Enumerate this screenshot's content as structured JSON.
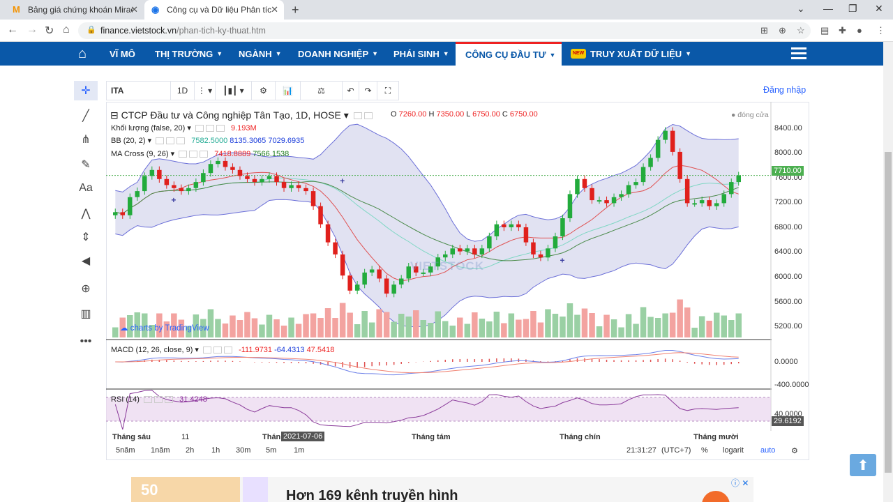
{
  "browser": {
    "tabs": [
      {
        "title": "Bảng giá chứng khoán Mirae Asset",
        "icon": "mirae-favicon",
        "active": false
      },
      {
        "title": "Công cụ và Dữ liệu Phân tích kỹ thuật",
        "icon": "vietstock-favicon",
        "active": true
      }
    ],
    "new_tab": "+",
    "url_host": "finance.vietstock.vn",
    "url_path": "/phan-tich-ky-thuat.htm"
  },
  "nav": {
    "items": [
      "VĨ MÔ",
      "THỊ TRƯỜNG",
      "NGÀNH",
      "DOANH NGHIỆP",
      "PHÁI SINH",
      "CÔNG CỤ ĐẦU TƯ",
      "TRUY XUẤT DỮ LIỆU"
    ],
    "active": "CÔNG CỤ ĐẦU TƯ",
    "new_badge": "NEW"
  },
  "toolbar": {
    "symbol": "ITA",
    "interval": "1D",
    "login": "Đăng nhập"
  },
  "legend": {
    "title": "CTCP Đầu tư và Công nghiệp Tân Tạo, 1D, HOSE",
    "o_label": "O",
    "o": "7260.00",
    "h_label": "H",
    "h": "7350.00",
    "l_label": "L",
    "l": "6750.00",
    "c_label": "C",
    "c": "6750.00",
    "status": "đóng cửa",
    "volume_label": "Khối lượng (false, 20)",
    "volume": "9.193M",
    "bb_label": "BB (20, 2)",
    "bb1": "7582.5000",
    "bb2": "8135.3065",
    "bb3": "7029.6935",
    "ma_label": "MA Cross (9, 26)",
    "ma1": "7418.8889",
    "ma2": "7566.1538",
    "macd_label": "MACD (12, 26, close, 9)",
    "macd1": "-111.9731",
    "macd2": "-64.4313",
    "macd3": "47.5418",
    "rsi_label": "RSI (14)",
    "rsi": "31.4248"
  },
  "y_axis": {
    "price_ticks": [
      "8400.00",
      "8000.00",
      "7600.00",
      "7200.00",
      "6800.00",
      "6400.00",
      "6000.00",
      "5600.00",
      "5200.00"
    ],
    "last_price": "7710.00",
    "macd_ticks": [
      "0.0000",
      "-400.0000"
    ],
    "rsi_ticks": [
      "40.0000"
    ],
    "rsi_last": "29.6192"
  },
  "x_axis": {
    "ticks": [
      "Tháng sáu",
      "11",
      "Thán",
      "Tháng tám",
      "Tháng chín",
      "Tháng mười"
    ],
    "crosshair_date": "2021-07-06"
  },
  "bottom": {
    "ranges": [
      "5năm",
      "1năm",
      "2h",
      "1h",
      "30m",
      "5m",
      "1m"
    ],
    "time": "21:31:27",
    "tz": "(UTC+7)",
    "pct": "%",
    "log": "logarit",
    "auto": "auto"
  },
  "watermark": "VIETSTOCK",
  "tv_credit": "charts by TradingView",
  "ad": {
    "text": "Hơn 169 kênh truyền hình",
    "badge": "50",
    "close": "ⓘ ✕"
  },
  "colors": {
    "nav_bg": "#0a58a8",
    "up": "#22ab3c",
    "down": "#e0201c",
    "bb_fill": "#c9cbe8",
    "rsi_fill": "#ead6ee"
  },
  "chart_data": {
    "type": "candlestick",
    "title": "CTCP Đầu tư và Công nghiệp Tân Tạo, 1D, HOSE",
    "ylim": [
      5000,
      8700
    ],
    "close_series": [
      7100,
      7050,
      7350,
      7450,
      7700,
      7800,
      7650,
      7550,
      7500,
      7450,
      7500,
      7600,
      7750,
      7900,
      7950,
      7850,
      7800,
      7700,
      7650,
      7600,
      7650,
      7700,
      7600,
      7500,
      7550,
      7500,
      7450,
      7200,
      6900,
      6600,
      6400,
      6050,
      5800,
      5900,
      6100,
      6150,
      6000,
      5750,
      5900,
      6000,
      6200,
      6100,
      6100,
      6200,
      6350,
      6400,
      6500,
      6450,
      6500,
      6400,
      6500,
      6700,
      6900,
      6850,
      6900,
      6850,
      6600,
      6400,
      6350,
      6500,
      6700,
      7000,
      7400,
      7650,
      7500,
      7300,
      7300,
      7250,
      7350,
      7400,
      7550,
      7600,
      7850,
      8000,
      8300,
      8450,
      8100,
      7650,
      7250,
      7250,
      7300,
      7200,
      7250,
      7400,
      7600,
      7710
    ]
  }
}
